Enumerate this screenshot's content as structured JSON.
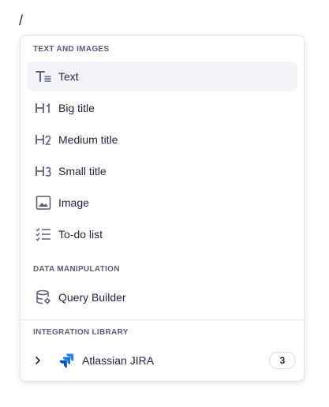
{
  "command_prefix": "/",
  "sections": {
    "text_and_images": {
      "header": "TEXT AND IMAGES",
      "items": [
        {
          "label": "Text",
          "icon": "text-icon"
        },
        {
          "label": "Big title",
          "icon": "h1-icon"
        },
        {
          "label": "Medium title",
          "icon": "h2-icon"
        },
        {
          "label": "Small title",
          "icon": "h3-icon"
        },
        {
          "label": "Image",
          "icon": "image-icon"
        },
        {
          "label": "To-do list",
          "icon": "todo-list-icon"
        }
      ]
    },
    "data_manipulation": {
      "header": "DATA MANIPULATION",
      "items": [
        {
          "label": "Query Builder",
          "icon": "database-gear-icon"
        }
      ]
    },
    "integration_library": {
      "header": "INTEGRATION LIBRARY",
      "items": [
        {
          "label": "Atlassian JIRA",
          "icon": "jira-logo-icon",
          "count": "3"
        }
      ]
    }
  },
  "colors": {
    "text": "#1f2340",
    "icon": "#5b5f7a",
    "header": "#5b5f7a",
    "active_bg": "#f3f4f7",
    "jira_blue": "#2684ff",
    "jira_dark": "#0052cc"
  }
}
